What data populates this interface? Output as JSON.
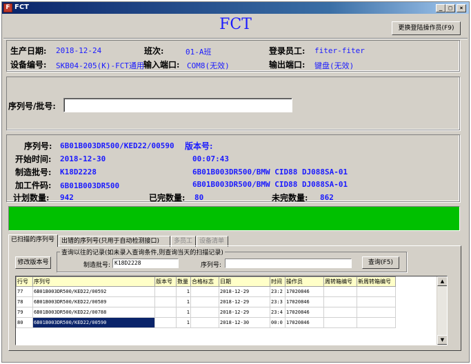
{
  "window": {
    "title": "FCT",
    "minimize": "_",
    "maximize": "□",
    "close": "×"
  },
  "header": {
    "app_title": "FCT",
    "change_operator_button": "更换登陆操作员(F9)"
  },
  "info": {
    "prod_date_label": "生产日期:",
    "prod_date_value": "2018-12-24",
    "shift_label": "班次:",
    "shift_value": "01-A班",
    "login_label": "登录员工:",
    "login_value": "fiter-fiter",
    "device_label": "设备编号:",
    "device_value": "SKB04-205(K)-FCT通用",
    "input_port_label": "输入端口:",
    "input_port_value": "COM8(无效)",
    "output_port_label": "输出端口:",
    "output_port_value": "键盘(无效)"
  },
  "scan": {
    "serial_batch_label": "序列号/批号:",
    "serial_batch_value": ""
  },
  "detail": {
    "serial_label": "序列号:",
    "serial_value": "6B01B003DR500/KED22/00590",
    "version_label": "版本号:",
    "start_label": "开始时间:",
    "start_date": "2018-12-30",
    "start_time": "00:07:43",
    "batch_label": "制造批号:",
    "batch_value": "K18D2228",
    "batch_desc": "6B01B003DR500/BMW CID88 DJ088SA-01",
    "part_label": "加工件码:",
    "part_value": "6B01B003DR500",
    "part_desc": "6B01B003DR500/BMW CID88 DJ088SA-01",
    "plan_label": "计划数量:",
    "plan_value": "942",
    "done_label": "已完数量:",
    "done_value": "80",
    "undone_label": "未完数量:",
    "undone_value": "862"
  },
  "status": {
    "color": "#00c000"
  },
  "tabs": [
    {
      "label": "已扫描的序列号",
      "active": true,
      "enabled": true
    },
    {
      "label": "出错的序列号(只用于自动检测接口)",
      "active": false,
      "enabled": true
    },
    {
      "label": "多员工",
      "active": false,
      "enabled": false
    },
    {
      "label": "设备清单",
      "active": false,
      "enabled": false
    }
  ],
  "query": {
    "modify_version_button": "修改版本号",
    "group_title": "查询以往的记录(如未录入查询条件,则查询当天的扫描记录)",
    "batch_label": "制造批号:",
    "batch_value": "K18D2228",
    "serial_label": "序列号:",
    "serial_value": "",
    "query_button": "查询(F5)"
  },
  "grid": {
    "columns": [
      "行号",
      "序列号",
      "版本号",
      "数量",
      "合格标志",
      "日期",
      "时间",
      "操作员",
      "周转箱编号",
      "新周转箱编号"
    ],
    "rows": [
      {
        "row": "77",
        "serial": "6B01B003DR500/KED22/00592",
        "version": "",
        "qty": "1",
        "pass": "",
        "date": "2018-12-29",
        "time": "23:2",
        "operator": "17020846",
        "box": "",
        "newbox": ""
      },
      {
        "row": "78",
        "serial": "6B01B003DR500/KED22/00589",
        "version": "",
        "qty": "1",
        "pass": "",
        "date": "2018-12-29",
        "time": "23:3",
        "operator": "17020846",
        "box": "",
        "newbox": ""
      },
      {
        "row": "79",
        "serial": "6B01B003DR500/KED22/00788",
        "version": "",
        "qty": "1",
        "pass": "",
        "date": "2018-12-29",
        "time": "23:4",
        "operator": "17020846",
        "box": "",
        "newbox": ""
      },
      {
        "row": "80",
        "serial": "6B01B003DR500/KED22/00590",
        "version": "",
        "qty": "1",
        "pass": "",
        "date": "2018-12-30",
        "time": "00:0",
        "operator": "17020846",
        "box": "",
        "newbox": ""
      }
    ],
    "selected_row": 3
  }
}
